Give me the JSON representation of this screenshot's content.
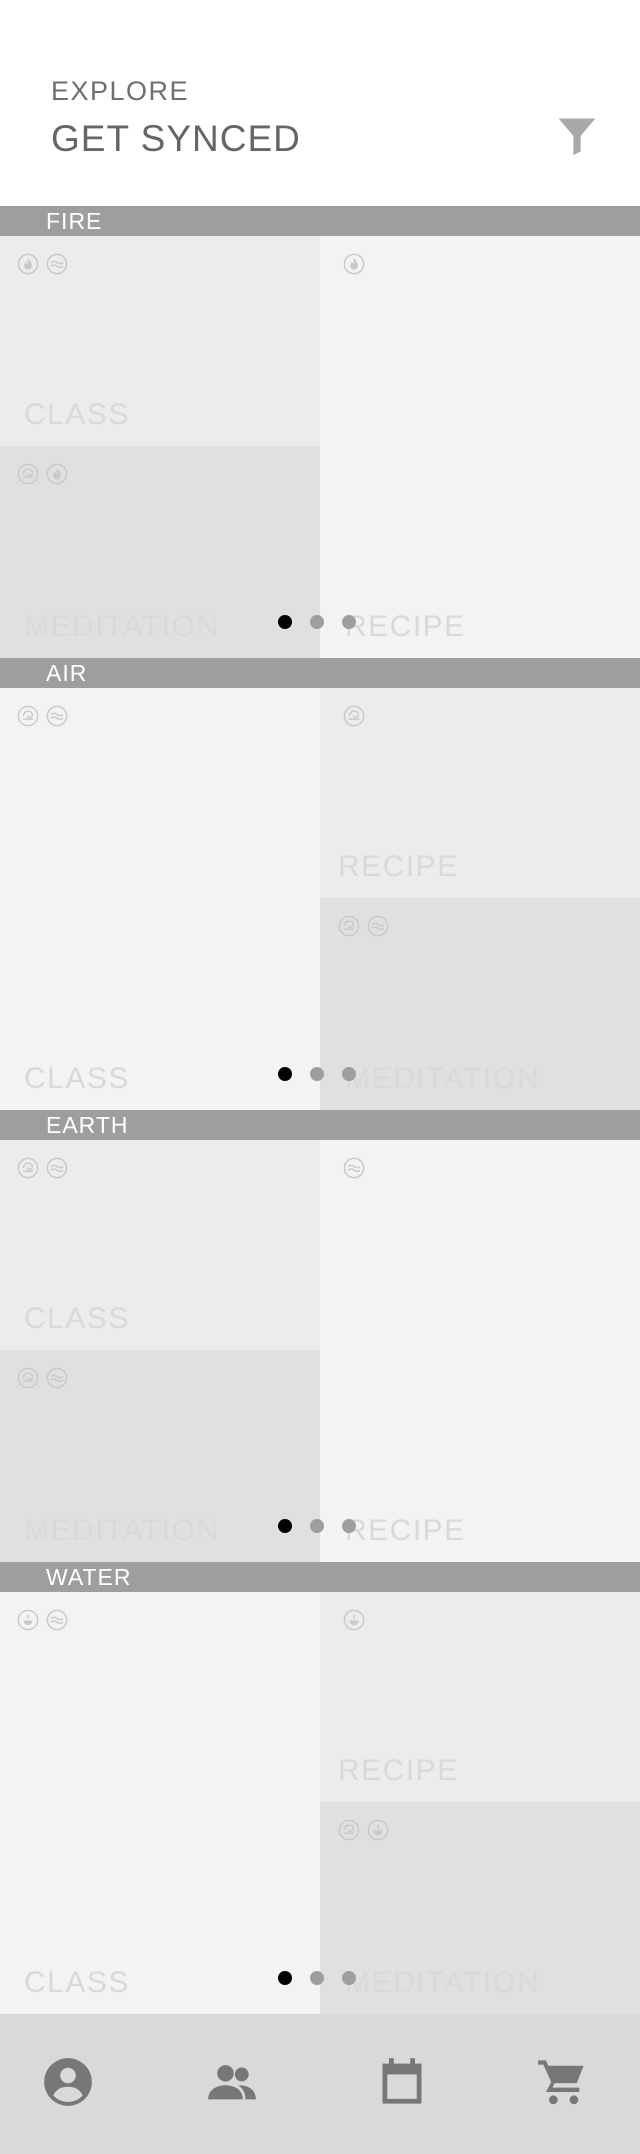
{
  "header": {
    "eyebrow": "EXPLORE",
    "title": "GET SYNCED",
    "filter_icon": "filter-funnel-icon"
  },
  "colors": {
    "section_bar": "#9e9e9e",
    "tile_light": "#f3f3f3",
    "tile_mid": "#ececec",
    "tile_dark": "#e0e0e0",
    "tile_label": "#d9d9d9",
    "dot_active": "#000000",
    "dot_inactive": "#9e9e9e",
    "tab_bar": "#d9d9d9",
    "tab_icon": "#777777"
  },
  "sections": [
    {
      "name": "FIRE",
      "tiles": [
        {
          "label": "CLASS",
          "icons": [
            "fire-icon",
            "water-icon"
          ]
        },
        {
          "label": "MEDITATION",
          "icons": [
            "air-icon",
            "fire-icon"
          ]
        },
        {
          "label": "RECIPE",
          "icons": [
            "fire-icon"
          ]
        }
      ],
      "pager": {
        "pages": 3,
        "active": 0
      }
    },
    {
      "name": "AIR",
      "tiles": [
        {
          "label": "CLASS",
          "icons": [
            "air-icon",
            "water-icon"
          ]
        },
        {
          "label": "RECIPE",
          "icons": [
            "air-icon"
          ]
        },
        {
          "label": "MEDITATION",
          "icons": [
            "air-icon",
            "water-icon"
          ]
        }
      ],
      "pager": {
        "pages": 3,
        "active": 0
      }
    },
    {
      "name": "EARTH",
      "tiles": [
        {
          "label": "CLASS",
          "icons": [
            "air-icon",
            "water-icon"
          ]
        },
        {
          "label": "MEDITATION",
          "icons": [
            "air-icon",
            "water-icon"
          ]
        },
        {
          "label": "RECIPE",
          "icons": [
            "water-icon"
          ]
        }
      ],
      "pager": {
        "pages": 3,
        "active": 0
      }
    },
    {
      "name": "WATER",
      "tiles": [
        {
          "label": "CLASS",
          "icons": [
            "earth-icon",
            "water-icon"
          ]
        },
        {
          "label": "RECIPE",
          "icons": [
            "earth-icon"
          ]
        },
        {
          "label": "MEDITATION",
          "icons": [
            "air-icon",
            "earth-icon"
          ]
        }
      ],
      "pager": {
        "pages": 3,
        "active": 0
      }
    }
  ],
  "tabbar": {
    "tabs": [
      "profile-icon",
      "community-icon",
      "calendar-icon",
      "cart-icon"
    ]
  }
}
